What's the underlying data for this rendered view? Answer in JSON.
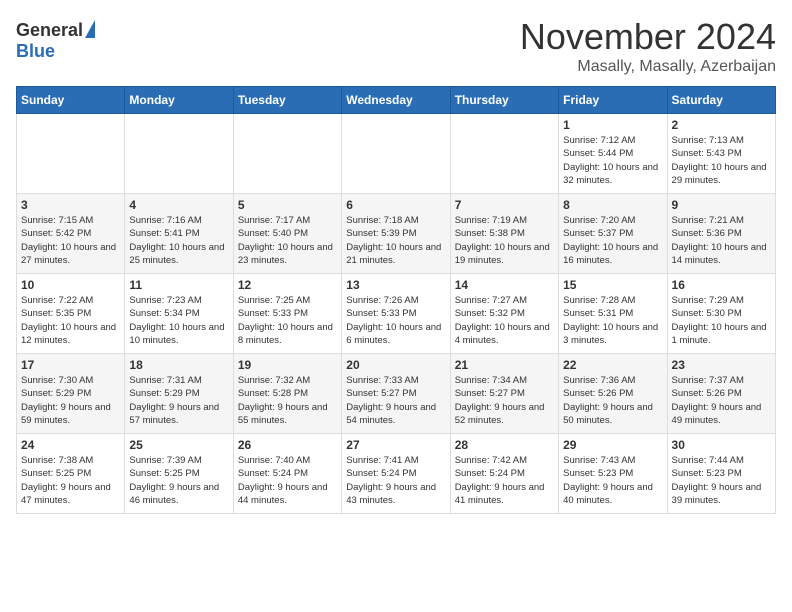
{
  "logo": {
    "general": "General",
    "blue": "Blue"
  },
  "title": {
    "month": "November 2024",
    "location": "Masally, Masally, Azerbaijan"
  },
  "weekdays": [
    "Sunday",
    "Monday",
    "Tuesday",
    "Wednesday",
    "Thursday",
    "Friday",
    "Saturday"
  ],
  "weeks": [
    [
      {
        "day": "",
        "info": ""
      },
      {
        "day": "",
        "info": ""
      },
      {
        "day": "",
        "info": ""
      },
      {
        "day": "",
        "info": ""
      },
      {
        "day": "",
        "info": ""
      },
      {
        "day": "1",
        "info": "Sunrise: 7:12 AM\nSunset: 5:44 PM\nDaylight: 10 hours and 32 minutes."
      },
      {
        "day": "2",
        "info": "Sunrise: 7:13 AM\nSunset: 5:43 PM\nDaylight: 10 hours and 29 minutes."
      }
    ],
    [
      {
        "day": "3",
        "info": "Sunrise: 7:15 AM\nSunset: 5:42 PM\nDaylight: 10 hours and 27 minutes."
      },
      {
        "day": "4",
        "info": "Sunrise: 7:16 AM\nSunset: 5:41 PM\nDaylight: 10 hours and 25 minutes."
      },
      {
        "day": "5",
        "info": "Sunrise: 7:17 AM\nSunset: 5:40 PM\nDaylight: 10 hours and 23 minutes."
      },
      {
        "day": "6",
        "info": "Sunrise: 7:18 AM\nSunset: 5:39 PM\nDaylight: 10 hours and 21 minutes."
      },
      {
        "day": "7",
        "info": "Sunrise: 7:19 AM\nSunset: 5:38 PM\nDaylight: 10 hours and 19 minutes."
      },
      {
        "day": "8",
        "info": "Sunrise: 7:20 AM\nSunset: 5:37 PM\nDaylight: 10 hours and 16 minutes."
      },
      {
        "day": "9",
        "info": "Sunrise: 7:21 AM\nSunset: 5:36 PM\nDaylight: 10 hours and 14 minutes."
      }
    ],
    [
      {
        "day": "10",
        "info": "Sunrise: 7:22 AM\nSunset: 5:35 PM\nDaylight: 10 hours and 12 minutes."
      },
      {
        "day": "11",
        "info": "Sunrise: 7:23 AM\nSunset: 5:34 PM\nDaylight: 10 hours and 10 minutes."
      },
      {
        "day": "12",
        "info": "Sunrise: 7:25 AM\nSunset: 5:33 PM\nDaylight: 10 hours and 8 minutes."
      },
      {
        "day": "13",
        "info": "Sunrise: 7:26 AM\nSunset: 5:33 PM\nDaylight: 10 hours and 6 minutes."
      },
      {
        "day": "14",
        "info": "Sunrise: 7:27 AM\nSunset: 5:32 PM\nDaylight: 10 hours and 4 minutes."
      },
      {
        "day": "15",
        "info": "Sunrise: 7:28 AM\nSunset: 5:31 PM\nDaylight: 10 hours and 3 minutes."
      },
      {
        "day": "16",
        "info": "Sunrise: 7:29 AM\nSunset: 5:30 PM\nDaylight: 10 hours and 1 minute."
      }
    ],
    [
      {
        "day": "17",
        "info": "Sunrise: 7:30 AM\nSunset: 5:29 PM\nDaylight: 9 hours and 59 minutes."
      },
      {
        "day": "18",
        "info": "Sunrise: 7:31 AM\nSunset: 5:29 PM\nDaylight: 9 hours and 57 minutes."
      },
      {
        "day": "19",
        "info": "Sunrise: 7:32 AM\nSunset: 5:28 PM\nDaylight: 9 hours and 55 minutes."
      },
      {
        "day": "20",
        "info": "Sunrise: 7:33 AM\nSunset: 5:27 PM\nDaylight: 9 hours and 54 minutes."
      },
      {
        "day": "21",
        "info": "Sunrise: 7:34 AM\nSunset: 5:27 PM\nDaylight: 9 hours and 52 minutes."
      },
      {
        "day": "22",
        "info": "Sunrise: 7:36 AM\nSunset: 5:26 PM\nDaylight: 9 hours and 50 minutes."
      },
      {
        "day": "23",
        "info": "Sunrise: 7:37 AM\nSunset: 5:26 PM\nDaylight: 9 hours and 49 minutes."
      }
    ],
    [
      {
        "day": "24",
        "info": "Sunrise: 7:38 AM\nSunset: 5:25 PM\nDaylight: 9 hours and 47 minutes."
      },
      {
        "day": "25",
        "info": "Sunrise: 7:39 AM\nSunset: 5:25 PM\nDaylight: 9 hours and 46 minutes."
      },
      {
        "day": "26",
        "info": "Sunrise: 7:40 AM\nSunset: 5:24 PM\nDaylight: 9 hours and 44 minutes."
      },
      {
        "day": "27",
        "info": "Sunrise: 7:41 AM\nSunset: 5:24 PM\nDaylight: 9 hours and 43 minutes."
      },
      {
        "day": "28",
        "info": "Sunrise: 7:42 AM\nSunset: 5:24 PM\nDaylight: 9 hours and 41 minutes."
      },
      {
        "day": "29",
        "info": "Sunrise: 7:43 AM\nSunset: 5:23 PM\nDaylight: 9 hours and 40 minutes."
      },
      {
        "day": "30",
        "info": "Sunrise: 7:44 AM\nSunset: 5:23 PM\nDaylight: 9 hours and 39 minutes."
      }
    ]
  ]
}
